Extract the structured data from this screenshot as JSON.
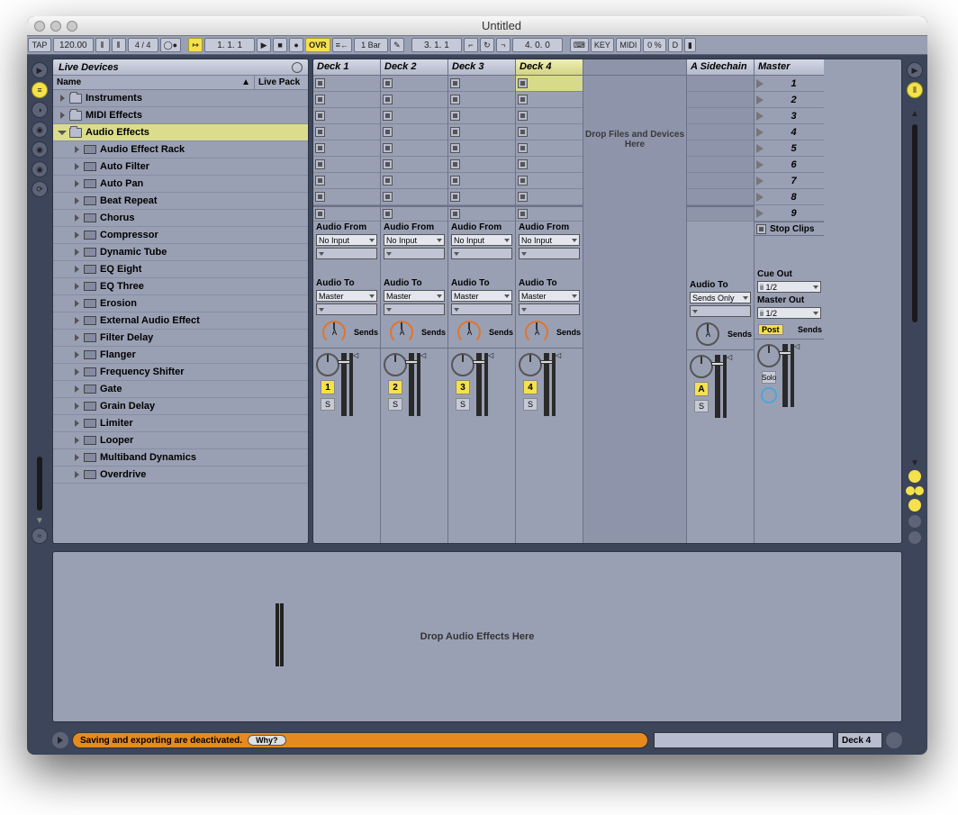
{
  "window_title": "Untitled",
  "toolbar": {
    "tap": "TAP",
    "tempo": "120.00",
    "timesig": "4 / 4",
    "pos1": "1.  1.  1",
    "ovr": "OVR",
    "bar_menu": "1 Bar",
    "pos2": "3.  1.  1",
    "pos3": "4.  0.  0",
    "key": "KEY",
    "midi": "MIDI",
    "pct": "0 %",
    "d": "D"
  },
  "browser": {
    "title": "Live Devices",
    "col1": "Name",
    "col2": "Live Pack",
    "items": [
      {
        "indent": 0,
        "open": false,
        "icon": "folder",
        "label": "Instruments"
      },
      {
        "indent": 0,
        "open": false,
        "icon": "folder",
        "label": "MIDI Effects"
      },
      {
        "indent": 0,
        "open": true,
        "icon": "folder",
        "label": "Audio Effects",
        "selected": true
      },
      {
        "indent": 1,
        "open": false,
        "icon": "device",
        "label": "Audio Effect Rack"
      },
      {
        "indent": 1,
        "open": false,
        "icon": "device",
        "label": "Auto Filter"
      },
      {
        "indent": 1,
        "open": false,
        "icon": "device",
        "label": "Auto Pan"
      },
      {
        "indent": 1,
        "open": false,
        "icon": "device",
        "label": "Beat Repeat"
      },
      {
        "indent": 1,
        "open": false,
        "icon": "device",
        "label": "Chorus"
      },
      {
        "indent": 1,
        "open": false,
        "icon": "device",
        "label": "Compressor"
      },
      {
        "indent": 1,
        "open": false,
        "icon": "device",
        "label": "Dynamic Tube"
      },
      {
        "indent": 1,
        "open": false,
        "icon": "device",
        "label": "EQ Eight"
      },
      {
        "indent": 1,
        "open": false,
        "icon": "device",
        "label": "EQ Three"
      },
      {
        "indent": 1,
        "open": false,
        "icon": "device",
        "label": "Erosion"
      },
      {
        "indent": 1,
        "open": false,
        "icon": "device",
        "label": "External Audio Effect"
      },
      {
        "indent": 1,
        "open": false,
        "icon": "device",
        "label": "Filter Delay"
      },
      {
        "indent": 1,
        "open": false,
        "icon": "device",
        "label": "Flanger"
      },
      {
        "indent": 1,
        "open": false,
        "icon": "device",
        "label": "Frequency Shifter"
      },
      {
        "indent": 1,
        "open": false,
        "icon": "device",
        "label": "Gate"
      },
      {
        "indent": 1,
        "open": false,
        "icon": "device",
        "label": "Grain Delay"
      },
      {
        "indent": 1,
        "open": false,
        "icon": "device",
        "label": "Limiter"
      },
      {
        "indent": 1,
        "open": false,
        "icon": "device",
        "label": "Looper"
      },
      {
        "indent": 1,
        "open": false,
        "icon": "device",
        "label": "Multiband Dynamics"
      },
      {
        "indent": 1,
        "open": false,
        "icon": "device",
        "label": "Overdrive"
      }
    ]
  },
  "tracks": [
    {
      "name": "Deck 1",
      "number": "1",
      "selected": false
    },
    {
      "name": "Deck 2",
      "number": "2",
      "selected": false
    },
    {
      "name": "Deck 3",
      "number": "3",
      "selected": false
    },
    {
      "name": "Deck 4",
      "number": "4",
      "selected": true
    }
  ],
  "returns": [
    {
      "name": "A Sidechain",
      "letter": "A"
    }
  ],
  "master": {
    "name": "Master",
    "scenes": [
      "1",
      "2",
      "3",
      "4",
      "5",
      "6",
      "7",
      "8",
      "9"
    ],
    "stop": "Stop Clips",
    "cue_label": "Cue Out",
    "cue_value": "ii 1/2",
    "master_label": "Master Out",
    "master_value": "ii 1/2",
    "solo": "Solo",
    "post": "Post"
  },
  "io": {
    "audio_from": "Audio From",
    "no_input": "No Input",
    "audio_to": "Audio To",
    "master": "Master",
    "sends_only": "Sends Only",
    "sends": "Sends",
    "s": "S"
  },
  "drop_tracks": "Drop Files and Devices Here",
  "effects": "Drop Audio Effects Here",
  "status": {
    "message": "Saving and exporting are deactivated.",
    "why": "Why?",
    "deck": "Deck 4"
  }
}
